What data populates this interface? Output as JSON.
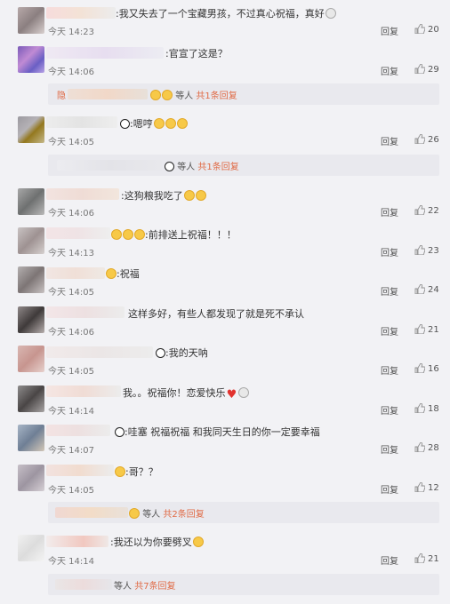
{
  "labels": {
    "reply": "回复",
    "others": "等人",
    "gong": "共",
    "replies_suffix": "条回复"
  },
  "colors": {
    "background": "#f2f2f5",
    "reply_count": "#e06a45",
    "like_icon": "#8f8f8f"
  },
  "comments": [
    {
      "text": ":我又失去了一个宝藏男孩，不过真心祝福，真好",
      "time": "今天 14:23",
      "likes": "20"
    },
    {
      "text": ":官宣了这是？",
      "time": "今天 14:06",
      "likes": "29"
    },
    {
      "text": ":嗯哼",
      "time": "今天 14:05",
      "likes": "26"
    },
    {
      "text": ":这狗粮我吃了",
      "time": "今天 14:06",
      "likes": "22"
    },
    {
      "text": ":前排送上祝福！！！",
      "time": "今天 14:13",
      "likes": "23"
    },
    {
      "text": ":祝福",
      "time": "今天 14:05",
      "likes": "24"
    },
    {
      "text": "这样多好，有些人都发现了就是死不承认",
      "time": "今天 14:06",
      "likes": "21"
    },
    {
      "text": ":我的天呐",
      "time": "今天 14:05",
      "likes": "16"
    },
    {
      "text": "我。。祝福你！恋爱快乐",
      "time": "今天 14:14",
      "likes": "18"
    },
    {
      "text": ":哇塞 祝福祝福 和我同天生日的你一定要幸福",
      "time": "今天 14:07",
      "likes": "28"
    },
    {
      "text": ":哥？？",
      "time": "今天 14:05",
      "likes": "12"
    },
    {
      "text": ":我还以为你要劈叉",
      "time": "今天 14:14",
      "likes": "21"
    }
  ],
  "subreplies": [
    {
      "count": "1",
      "lead": "隐"
    },
    {
      "count": "1"
    },
    {
      "count": "2"
    },
    {
      "count": "7"
    }
  ]
}
